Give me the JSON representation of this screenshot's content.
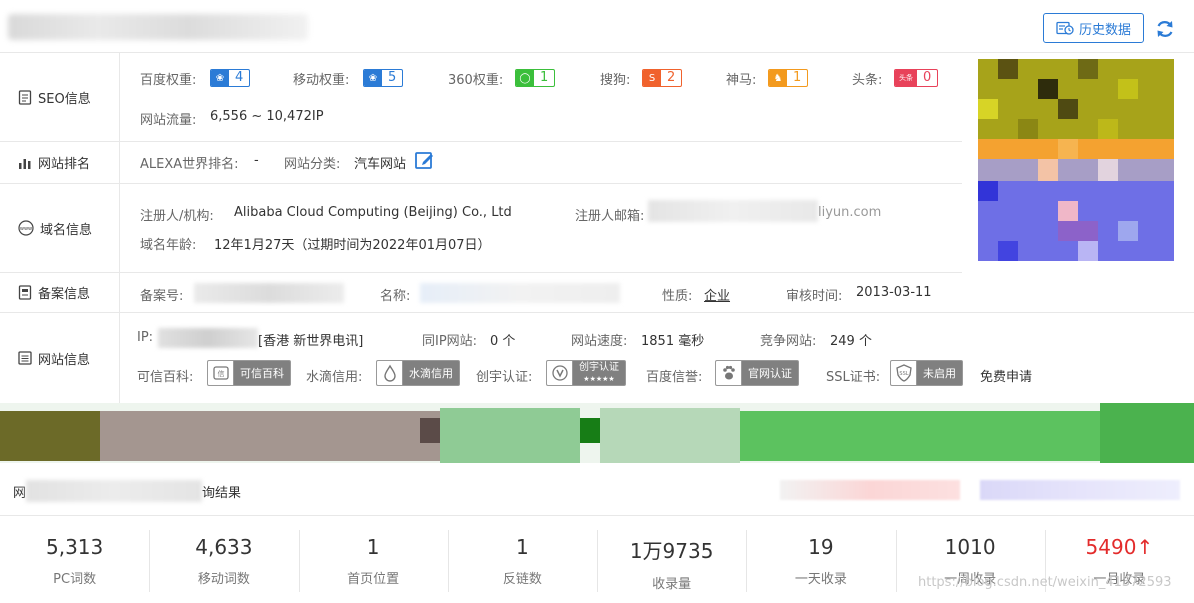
{
  "header": {
    "history_button": "历史数据"
  },
  "nav": [
    {
      "label": "SEO信息"
    },
    {
      "label": "网站排名"
    },
    {
      "label": "域名信息"
    },
    {
      "label": "备案信息"
    },
    {
      "label": "网站信息"
    }
  ],
  "seo": {
    "baidu": {
      "label": "百度权重:",
      "value": "4"
    },
    "mobile": {
      "label": "移动权重:",
      "value": "5"
    },
    "s360": {
      "label": "360权重:",
      "value": "1"
    },
    "sogou": {
      "label": "搜狗:",
      "value": "2"
    },
    "shenma": {
      "label": "神马:",
      "value": "1"
    },
    "toutiao": {
      "label": "头条:",
      "value": "0"
    },
    "traffic_label": "网站流量:",
    "traffic_value": "6,556 ~ 10,472IP"
  },
  "rank": {
    "alexa_label": "ALEXA世界排名:",
    "alexa_value": "-",
    "category_label": "网站分类:",
    "category_value": "汽车网站"
  },
  "domain": {
    "registrant_label": "注册人/机构:",
    "registrant_value": "Alibaba Cloud Computing (Beijing) Co., Ltd",
    "email_label": "注册人邮箱:",
    "email_visible": "liyun.com",
    "age_label": "域名年龄:",
    "age_value": "12年1月27天（过期时间为2022年01月07日）"
  },
  "icp": {
    "number_label": "备案号:",
    "name_label": "名称:",
    "nature_label": "性质:",
    "nature_value": "企业",
    "audit_label": "审核时间:",
    "audit_value": "2013-03-11"
  },
  "site": {
    "ip_label": "IP:",
    "ip_location": "[香港 新世界电讯]",
    "same_ip_label": "同IP网站:",
    "same_ip_value": "0 个",
    "speed_label": "网站速度:",
    "speed_value": "1851 毫秒",
    "competitor_label": "竞争网站:",
    "competitor_value": "249 个",
    "kexin_label": "可信百科:",
    "kexin_badge": "可信百科",
    "shuidi_label": "水滴信用:",
    "shuidi_badge": "水滴信用",
    "chuangyu_label": "创宇认证:",
    "chuangyu_badge": "创宇认证",
    "baidu_credit_label": "百度信誉:",
    "baidu_credit_badge": "官网认证",
    "ssl_label": "SSL证书:",
    "ssl_badge": "未启用",
    "ssl_link": "免费申请"
  },
  "results": {
    "title_prefix": "网",
    "title_suffix": "询结果",
    "stats": [
      {
        "value": "5,313",
        "label": "PC词数"
      },
      {
        "value": "4,633",
        "label": "移动词数"
      },
      {
        "value": "1",
        "label": "首页位置"
      },
      {
        "value": "1",
        "label": "反链数"
      },
      {
        "value": "1万9735",
        "label": "收录量"
      },
      {
        "value": "19",
        "label": "一天收录"
      },
      {
        "value": "1010",
        "label": "一周收录"
      },
      {
        "value": "5490",
        "label": "一月收录",
        "arrow": "↑"
      }
    ]
  },
  "watermark": "https://blog.csdn.net/weixin_41372593",
  "colors": {
    "accent": "#2b7bd6",
    "red": "#e32b2b"
  }
}
